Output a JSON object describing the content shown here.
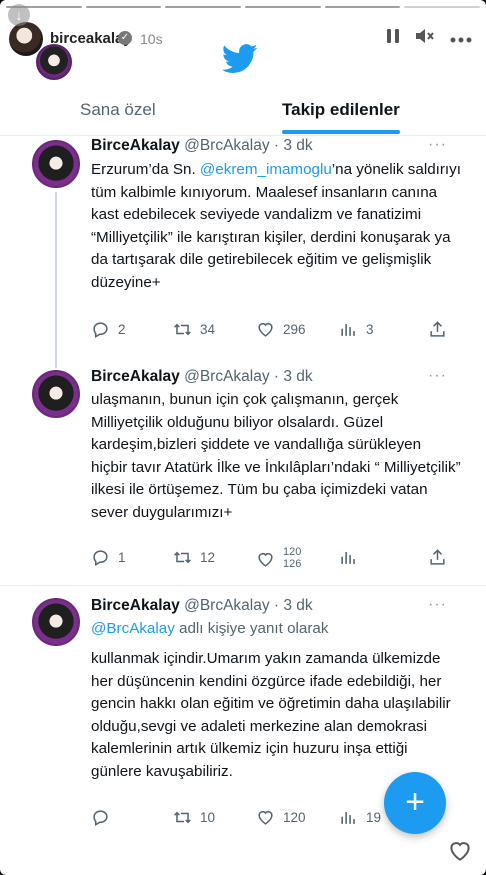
{
  "story": {
    "username": "birceakalay",
    "time": "10s",
    "verified_mark": "✓",
    "progress_segments": 6,
    "progress_done": 5
  },
  "twitter": {
    "tabs": [
      {
        "label": "Sana özel",
        "active": false
      },
      {
        "label": "Takip edilenler",
        "active": true
      }
    ],
    "accent": "#1d9bf0"
  },
  "tweets": [
    {
      "name": "BirceAkalay",
      "handle": "@BrcAkalay",
      "time": "· 3 dk",
      "more": "···",
      "text_before": "Erzurum’da Sn. ",
      "mention": "@ekrem_imamoglu",
      "text_after": "’na yönelik saldırıyı tüm kalbimle kınıyorum. Maalesef insanların canına kast edebilecek seviyede vandalizm ve fanatizimi “Milliyetçilik” ile karıştıran kişiler, derdini konuşarak ya da tartışarak dile getirebilecek eğitim ve gelişmişlik düzeyine+",
      "replies": "2",
      "retweets": "34",
      "likes": "296",
      "views": "3"
    },
    {
      "name": "BirceAkalay",
      "handle": "@BrcAkalay",
      "time": "· 3 dk",
      "more": "···",
      "text": "ulaşmanın, bunun için çok çalışmanın, gerçek Milliyetçilik olduğunu biliyor olsalardı. Güzel kardeşim,bizleri şiddete ve vandallığa sürükleyen hiçbir tavır Atatürk İlke ve İnkılâpları’ndaki “ Milliyetçilik” ilkesi ile örtüşemez. Tüm bu çaba içimizdeki vatan sever duygularımızı+",
      "replies": "1",
      "retweets": "12",
      "likes_top": "120",
      "likes_bottom": "126",
      "views": ""
    },
    {
      "name": "BirceAkalay",
      "handle": "@BrcAkalay",
      "time": "· 3 dk",
      "more": "···",
      "reply_mention": "@BrcAkalay",
      "reply_text": " adlı kişiye yanıt olarak",
      "text": "kullanmak içindir.Umarım yakın zamanda ülkemizde her düşüncenin kendini özgürce ifade edebildiği, her gencin hakkı olan eğitim ve öğretimin daha ulaşılabilir olduğu,sevgi ve adaleti merkezine alan demokrasi kalemlerinin artık ülkemiz için huzuru inşa ettiği günlere kavuşabiliriz.",
      "replies": "",
      "retweets": "10",
      "likes": "120",
      "views": "19"
    }
  ],
  "fab": {
    "label": "+"
  },
  "icons": [
    "download-icon",
    "verified-icon",
    "pause-icon",
    "mute-icon",
    "more-icon",
    "twitter-bird-icon",
    "reply-icon",
    "retweet-icon",
    "like-icon",
    "views-icon",
    "share-icon",
    "heart-icon"
  ]
}
